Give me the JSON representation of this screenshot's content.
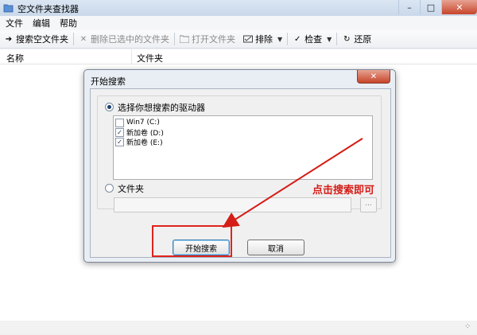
{
  "window": {
    "title": "空文件夹查找器"
  },
  "menu": [
    "文件",
    "编辑",
    "帮助"
  ],
  "toolbar": {
    "search": "搜索空文件夹",
    "delete_selected": "删除已选中的文件夹",
    "open_folder": "打开文件夹",
    "exclude": "排除",
    "check": "检查",
    "restore": "还原"
  },
  "list": {
    "col_name": "名称",
    "col_folder": "文件夹"
  },
  "dialog": {
    "title": "开始搜索",
    "drives_option": "选择你想搜索的驱动器",
    "drives": [
      {
        "label": "Win7 (C:)",
        "checked": false
      },
      {
        "label": "新加卷 (D:)",
        "checked": true
      },
      {
        "label": "新加卷 (E:)",
        "checked": true
      }
    ],
    "folder_option": "文件夹",
    "folder_value": "",
    "browse_label": "...",
    "start_button": "开始搜索",
    "cancel_button": "取消"
  },
  "annotation": {
    "text": "点击搜索即可",
    "color": "#d51c16"
  }
}
